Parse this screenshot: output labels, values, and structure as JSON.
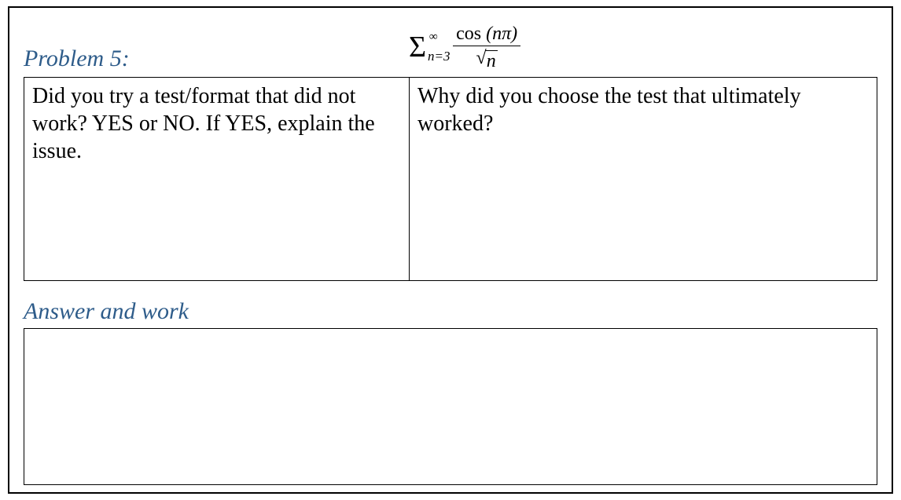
{
  "header": {
    "problem_label": "Problem 5:",
    "formula": {
      "sigma": "Σ",
      "upper": "∞",
      "lower": "n=3",
      "numerator_func": "cos",
      "numerator_arg": "(nπ)",
      "denom_sqrt_sym": "√",
      "denom_arg": "n"
    }
  },
  "questions": {
    "left": "Did you try a test/format that did not work? YES or NO. If YES, explain the issue.",
    "right": "Why did you choose the test that ultimately worked?"
  },
  "answer_label": "Answer and work"
}
